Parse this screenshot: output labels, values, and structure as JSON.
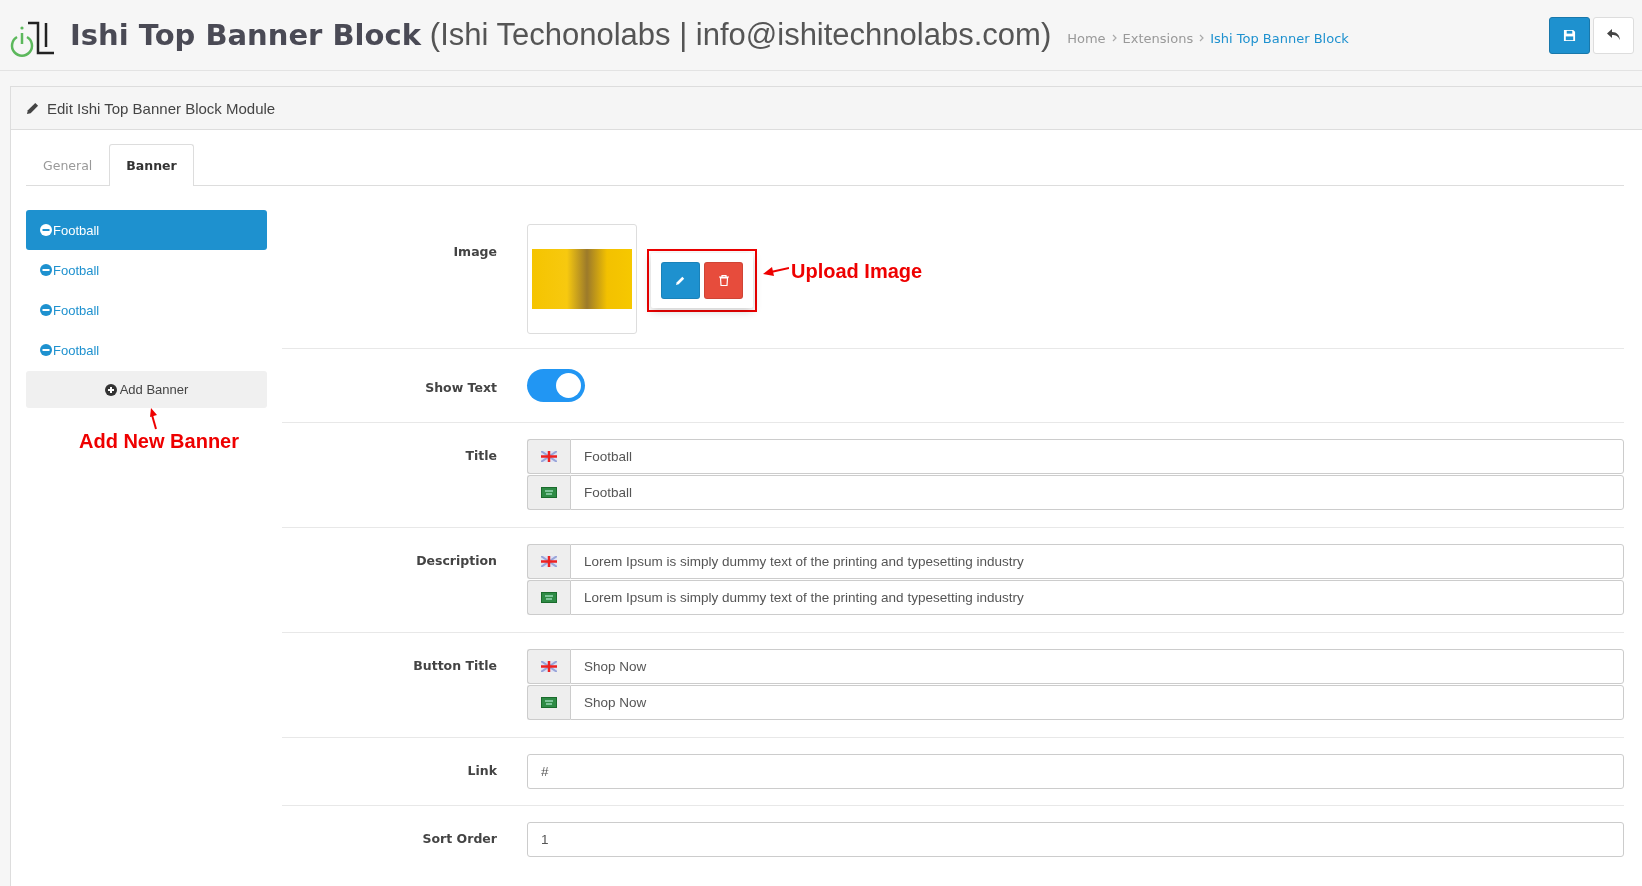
{
  "header": {
    "title": "Ishi Top Banner Block",
    "subtitle": "(Ishi Techonolabs | info@ishitechnolabs.com)",
    "breadcrumbs": [
      {
        "label": "Home",
        "selected": false
      },
      {
        "label": "Extensions",
        "selected": false
      },
      {
        "label": "Ishi Top Banner Block",
        "selected": true
      }
    ]
  },
  "panel": {
    "heading": "Edit Ishi Top Banner Block Module",
    "tabs": [
      {
        "label": "General",
        "selected": false
      },
      {
        "label": "Banner",
        "selected": true
      }
    ],
    "banners": [
      {
        "label": "Football",
        "selected": true
      },
      {
        "label": "Football",
        "selected": false
      },
      {
        "label": "Football",
        "selected": false
      },
      {
        "label": "Football",
        "selected": false
      }
    ],
    "add_button": "Add Banner",
    "add_note": "Add New Banner",
    "form": [
      {
        "kind": "image",
        "label": "Image",
        "note": "Upload Image"
      },
      {
        "kind": "toggle",
        "label": "Show Text",
        "on": true
      },
      {
        "kind": "multilang",
        "label": "Title",
        "values": [
          {
            "kind": "uk",
            "value": "Football"
          },
          {
            "kind": "sa",
            "value": "Football"
          }
        ]
      },
      {
        "kind": "multilang",
        "label": "Description",
        "values": [
          {
            "kind": "uk",
            "value": "Lorem Ipsum is simply dummy text of the printing and typesetting industry"
          },
          {
            "kind": "sa",
            "value": "Lorem Ipsum is simply dummy text of the printing and typesetting industry"
          }
        ]
      },
      {
        "kind": "multilang",
        "label": "Button Title",
        "values": [
          {
            "kind": "uk",
            "value": "Shop Now"
          },
          {
            "kind": "sa",
            "value": "Shop Now"
          }
        ]
      },
      {
        "kind": "text",
        "label": "Link",
        "value": "#"
      },
      {
        "kind": "text",
        "label": "Sort Order",
        "value": "1"
      }
    ]
  }
}
